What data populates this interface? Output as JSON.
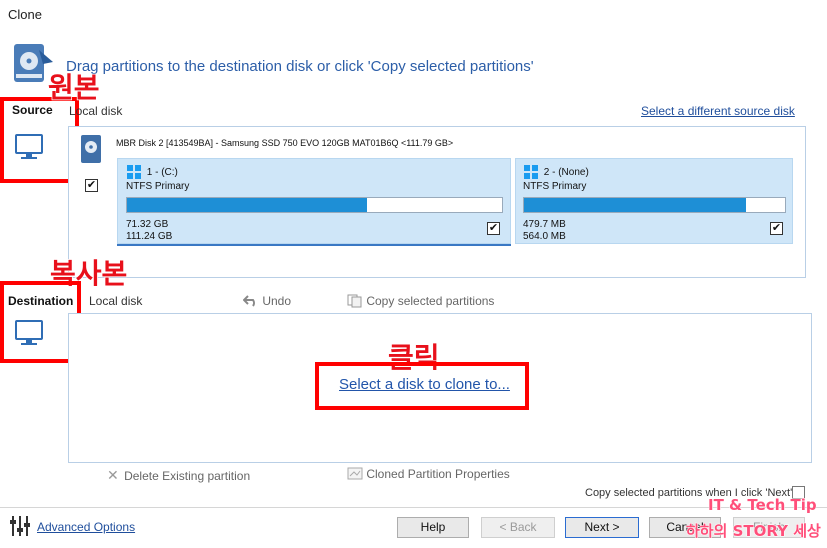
{
  "window": {
    "title": "Clone"
  },
  "header": {
    "instruction": "Drag partitions to the destination disk or click 'Copy selected partitions'"
  },
  "source": {
    "side_label": "Source",
    "pane_label": "Local disk",
    "change_link": "Select a different source disk",
    "disk": {
      "description": "MBR Disk 2 [413549BA] - Samsung SSD 750 EVO 120GB MAT01B6Q  <111.79 GB>",
      "checked": true,
      "partitions": [
        {
          "name": "1 - (C:)",
          "type": "NTFS Primary",
          "used": "71.32 GB",
          "total": "111.24 GB",
          "used_fraction": 0.64,
          "checked": true
        },
        {
          "name": "2 - (None)",
          "type": "NTFS Primary",
          "used": "479.7 MB",
          "total": "564.0 MB",
          "used_fraction": 0.85,
          "checked": true
        }
      ]
    }
  },
  "destination": {
    "side_label": "Destination",
    "pane_label": "Local disk",
    "undo_label": "Undo",
    "copy_label": "Copy selected partitions",
    "select_link": "Select a disk to clone to...",
    "delete_label": "Delete Existing partition",
    "props_label": "Cloned Partition Properties",
    "auto_copy_label": "Copy selected partitions when I click 'Next'"
  },
  "annotations": {
    "source_kor": "원본",
    "dest_kor": "복사본",
    "click_kor": "클릭",
    "color": "#ff0000"
  },
  "footer": {
    "advanced_link": "Advanced Options",
    "help": "Help",
    "back": "< Back",
    "next": "Next >",
    "cancel": "Cancel",
    "finish": "Finish"
  },
  "watermark": {
    "line1": "IT & Tech Tip",
    "line2": "하하의 STORY 세상"
  },
  "icons": [
    "clone-disk-icon",
    "monitor-icon",
    "disk-icon",
    "windows-icon",
    "undo-icon",
    "copy-icon",
    "delete-icon",
    "properties-icon",
    "sliders-icon"
  ]
}
